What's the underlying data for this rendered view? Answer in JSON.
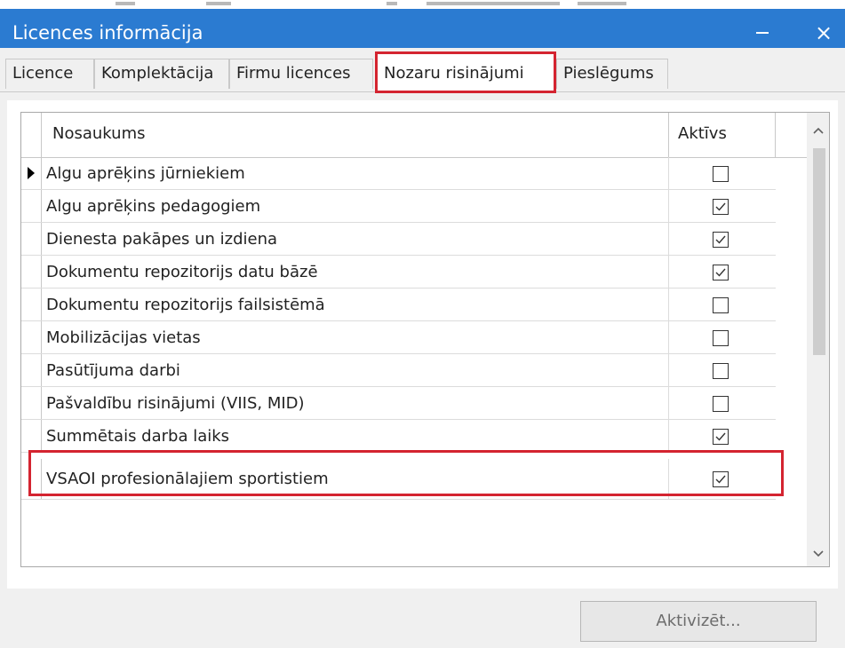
{
  "window": {
    "title": "Licences informācija",
    "minimize_symbol": "–",
    "close_symbol": "×"
  },
  "tabs": [
    {
      "label": "Licence",
      "active": false
    },
    {
      "label": "Komplektācija",
      "active": false
    },
    {
      "label": "Firmu licences",
      "active": false
    },
    {
      "label": "Nozaru risinājumi",
      "active": true
    },
    {
      "label": "Pieslēgums",
      "active": false
    }
  ],
  "grid": {
    "columns": [
      "Nosaukums",
      "Aktīvs"
    ],
    "rows": [
      {
        "name": "Algu aprēķins jūrniekiem",
        "active": false,
        "current": true
      },
      {
        "name": "Algu aprēķins pedagogiem",
        "active": true
      },
      {
        "name": "Dienesta pakāpes un izdiena",
        "active": true
      },
      {
        "name": "Dokumentu repozitorijs datu bāzē",
        "active": true
      },
      {
        "name": "Dokumentu repozitorijs failsistēmā",
        "active": false
      },
      {
        "name": "Mobilizācijas vietas",
        "active": false
      },
      {
        "name": "Pasūtījuma darbi",
        "active": false
      },
      {
        "name": "Pašvaldību risinājumi (VIIS, MID)",
        "active": false
      },
      {
        "name": "Summētais darba laiks",
        "active": true
      },
      {
        "name": "VSAOI profesionālajiem sportistiem",
        "active": true
      }
    ]
  },
  "buttons": {
    "activate_label": "Aktivizēt..."
  },
  "colors": {
    "titlebar": "#2b7bd1",
    "highlight": "#d42430"
  }
}
